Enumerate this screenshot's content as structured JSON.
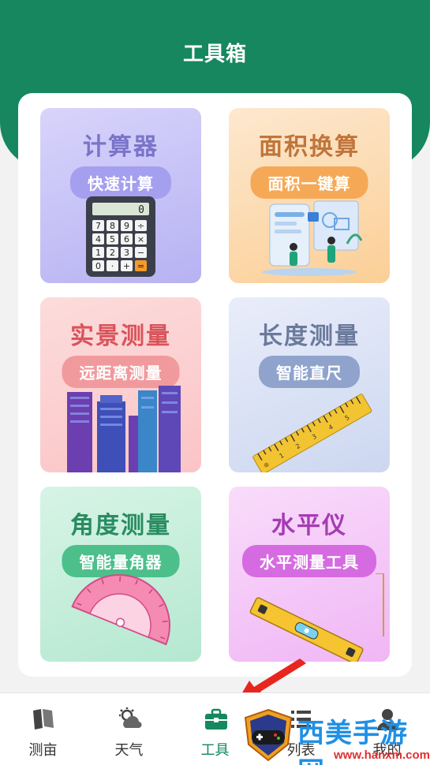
{
  "header": {
    "title": "工具箱"
  },
  "cards": [
    {
      "title": "计算器",
      "subtitle": "快速计算",
      "display": "0",
      "keys": [
        "7",
        "8",
        "9",
        "÷",
        "4",
        "5",
        "6",
        "×",
        "1",
        "2",
        "3",
        "−",
        "0",
        "·",
        "+",
        "="
      ]
    },
    {
      "title": "面积换算",
      "subtitle": "面积一键算"
    },
    {
      "title": "实景测量",
      "subtitle": "远距离测量"
    },
    {
      "title": "长度测量",
      "subtitle": "智能直尺",
      "ruler_marks": [
        "1",
        "2",
        "3",
        "4",
        "5"
      ]
    },
    {
      "title": "角度测量",
      "subtitle": "智能量角器"
    },
    {
      "title": "水平仪",
      "subtitle": "水平测量工具"
    }
  ],
  "tabbar": {
    "items": [
      {
        "label": "测亩",
        "icon": "map-icon"
      },
      {
        "label": "天气",
        "icon": "weather-icon"
      },
      {
        "label": "工具",
        "icon": "toolbox-icon",
        "active": true
      },
      {
        "label": "列表",
        "icon": "list-icon"
      },
      {
        "label": "我的",
        "icon": "user-icon"
      }
    ]
  },
  "watermark": {
    "text": "西美手游网",
    "url": "www.hanxm.com"
  },
  "colors": {
    "brand": "#16875f",
    "arrow": "#e8251f"
  }
}
